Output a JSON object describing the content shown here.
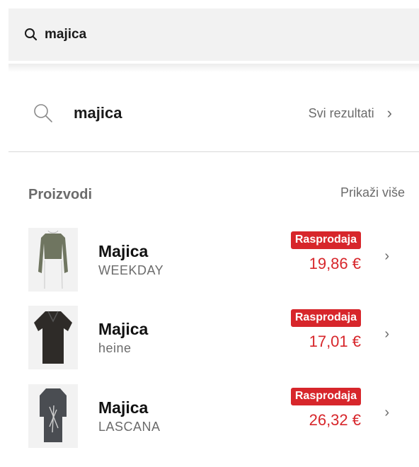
{
  "search": {
    "value": "majica",
    "icon": "search-icon"
  },
  "suggestion": {
    "term": "majica",
    "all_results_label": "Svi rezultati",
    "chevron": "›"
  },
  "products_section": {
    "title": "Proizvodi",
    "show_more_label": "Prikaži više",
    "items": [
      {
        "name": "Majica",
        "brand": "WEEKDAY",
        "badge": "Rasprodaja",
        "price": "19,86 €",
        "chevron": "›"
      },
      {
        "name": "Majica",
        "brand": "heine",
        "badge": "Rasprodaja",
        "price": "17,01 €",
        "chevron": "›"
      },
      {
        "name": "Majica",
        "brand": "LASCANA",
        "badge": "Rasprodaja",
        "price": "26,32 €",
        "chevron": "›"
      }
    ]
  },
  "colors": {
    "sale_red": "#d7262b",
    "muted_text": "#6b6b6b",
    "search_bg": "#f2f2f2"
  }
}
